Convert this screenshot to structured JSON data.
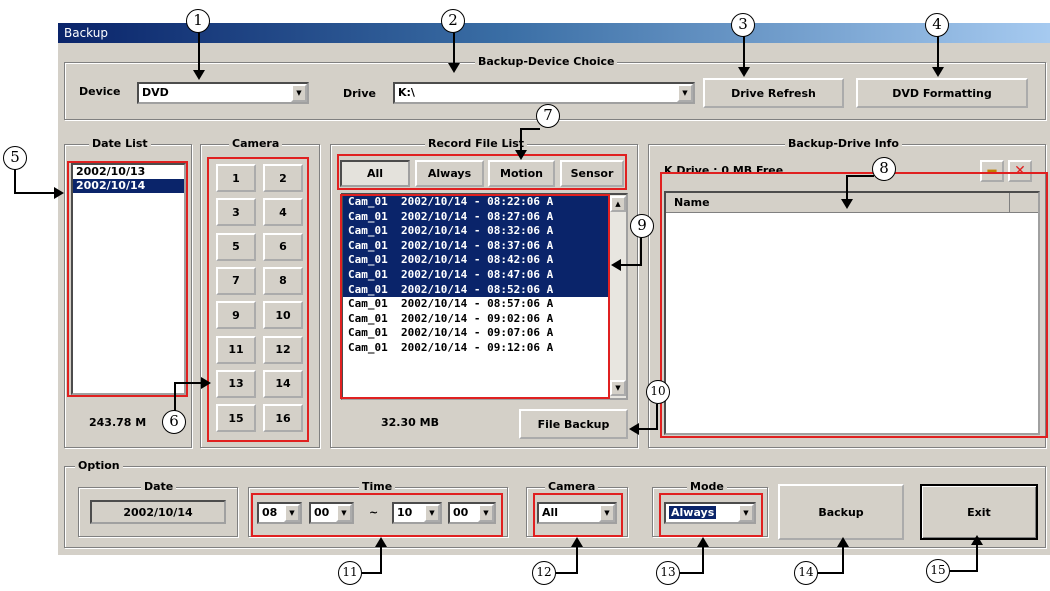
{
  "window": {
    "title": "Backup"
  },
  "device_choice": {
    "group_label": "Backup-Device Choice",
    "device_label": "Device",
    "device_value": "DVD",
    "drive_label": "Drive",
    "drive_value": "K:\\",
    "drive_refresh": "Drive Refresh",
    "dvd_formatting": "DVD Formatting"
  },
  "date_list": {
    "label": "Date List",
    "items": [
      "2002/10/13",
      "2002/10/14"
    ],
    "selected": "2002/10/14",
    "size": "243.78 M"
  },
  "camera": {
    "label": "Camera",
    "buttons": [
      "1",
      "2",
      "3",
      "4",
      "5",
      "6",
      "7",
      "8",
      "9",
      "10",
      "11",
      "12",
      "13",
      "14",
      "15",
      "16"
    ]
  },
  "record_file_list": {
    "label": "Record File List",
    "filters": [
      "All",
      "Always",
      "Motion",
      "Sensor"
    ],
    "files": [
      {
        "text": "Cam_01  2002/10/14 - 08:22:06 A",
        "selected": true
      },
      {
        "text": "Cam_01  2002/10/14 - 08:27:06 A",
        "selected": true
      },
      {
        "text": "Cam_01  2002/10/14 - 08:32:06 A",
        "selected": true
      },
      {
        "text": "Cam_01  2002/10/14 - 08:37:06 A",
        "selected": true
      },
      {
        "text": "Cam_01  2002/10/14 - 08:42:06 A",
        "selected": true
      },
      {
        "text": "Cam_01  2002/10/14 - 08:47:06 A",
        "selected": true
      },
      {
        "text": "Cam_01  2002/10/14 - 08:52:06 A",
        "selected": true
      },
      {
        "text": "Cam_01  2002/10/14 - 08:57:06 A",
        "selected": false
      },
      {
        "text": "Cam_01  2002/10/14 - 09:02:06 A",
        "selected": false
      },
      {
        "text": "Cam_01  2002/10/14 - 09:07:06 A",
        "selected": false
      },
      {
        "text": "Cam_01  2002/10/14 - 09:12:06 A",
        "selected": false
      }
    ],
    "size": "32.30 MB",
    "file_backup": "File Backup"
  },
  "backup_drive_info": {
    "label": "Backup-Drive Info",
    "drive_text": "K Drive : 0 MB Free",
    "name_header": "Name"
  },
  "option": {
    "label": "Option",
    "date_label": "Date",
    "date_value": "2002/10/14",
    "time_label": "Time",
    "start_hour": "08",
    "start_min": "00",
    "sep": "~",
    "end_hour": "10",
    "end_min": "00",
    "camera_label": "Camera",
    "camera_value": "All",
    "mode_label": "Mode",
    "mode_value": "Always",
    "backup": "Backup",
    "exit": "Exit"
  },
  "callouts": [
    "1",
    "2",
    "3",
    "4",
    "5",
    "6",
    "7",
    "8",
    "9",
    "10",
    "11",
    "12",
    "13",
    "14",
    "15"
  ],
  "colors": {
    "red_outline": "#e02020",
    "selection": "#0a246a",
    "face": "#d4d0c8"
  }
}
